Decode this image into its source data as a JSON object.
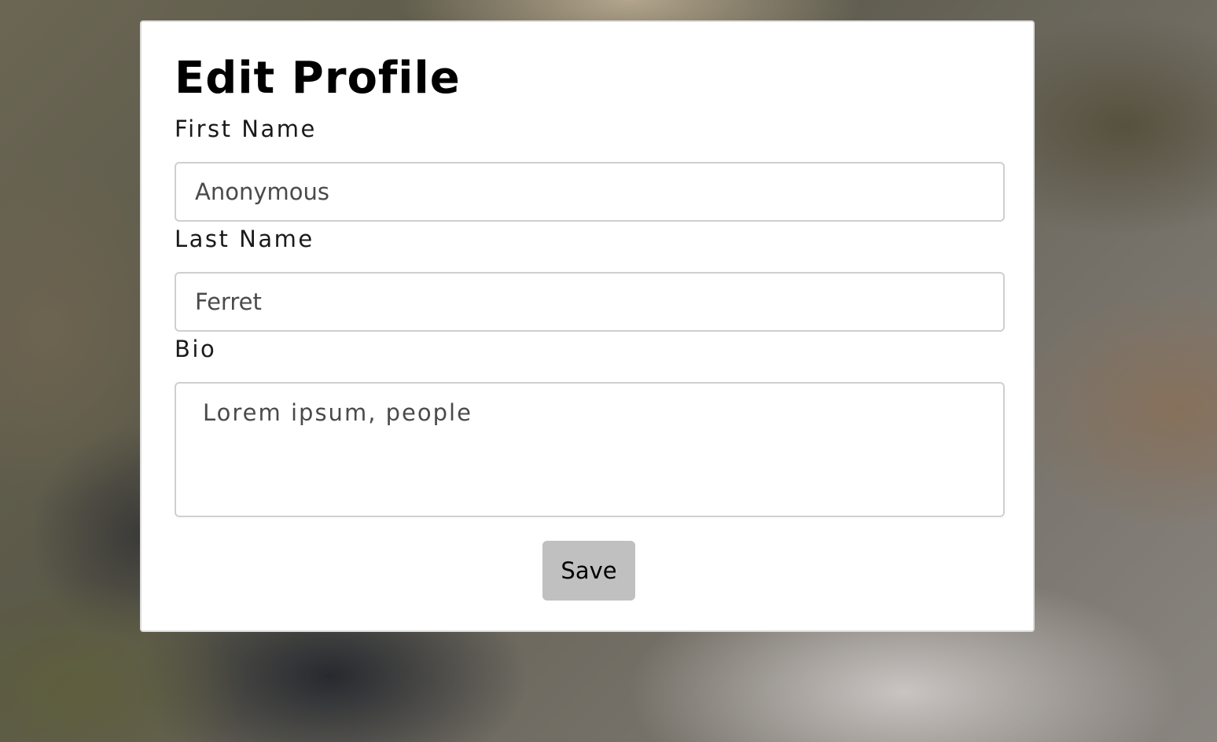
{
  "form": {
    "title": "Edit Profile",
    "first_name": {
      "label": "First Name",
      "value": "Anonymous"
    },
    "last_name": {
      "label": "Last Name",
      "value": "Ferret"
    },
    "bio": {
      "label": "Bio",
      "value": "Lorem ipsum, people"
    },
    "save_label": "Save"
  },
  "colors": {
    "card_background": "#ffffff",
    "button_background": "#c0c0c0",
    "input_border": "#cfcfcf",
    "title_text": "#000000"
  }
}
